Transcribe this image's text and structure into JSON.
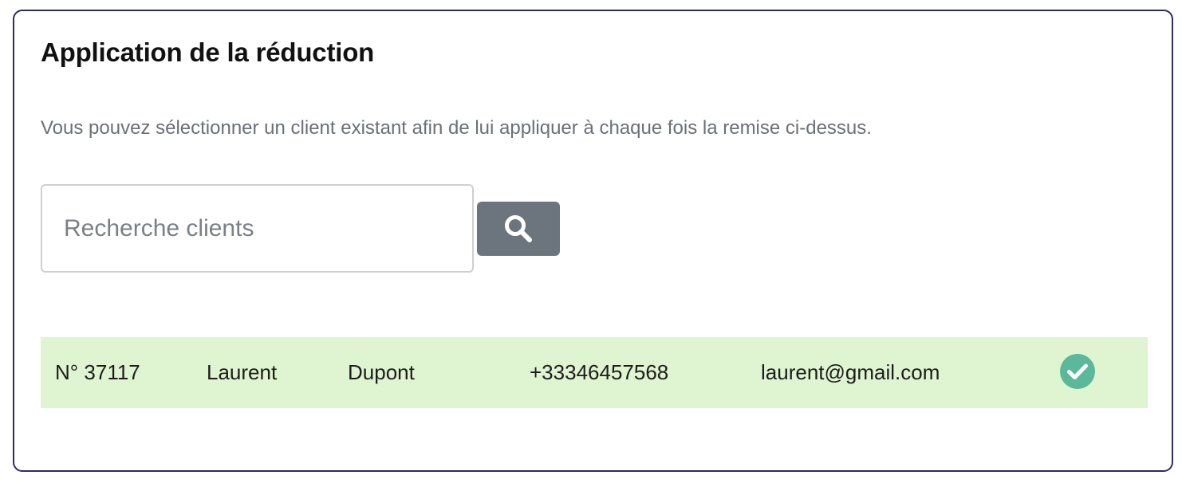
{
  "panel": {
    "title": "Application de la réduction",
    "description": "Vous pouvez sélectionner un client existant afin de lui appliquer à chaque fois la remise ci-dessus."
  },
  "search": {
    "placeholder": "Recherche clients",
    "value": "",
    "button_icon": "search-icon"
  },
  "client": {
    "number": "N° 37117",
    "first_name": "Laurent",
    "last_name": "Dupont",
    "phone": "+33346457568",
    "email": "laurent@gmail.com",
    "status_icon": "check-circle-icon",
    "selected": true
  },
  "colors": {
    "panel_border": "#2f2a6b",
    "search_button": "#6c747d",
    "row_background": "#dff4d0",
    "check": "#5bb89a"
  }
}
